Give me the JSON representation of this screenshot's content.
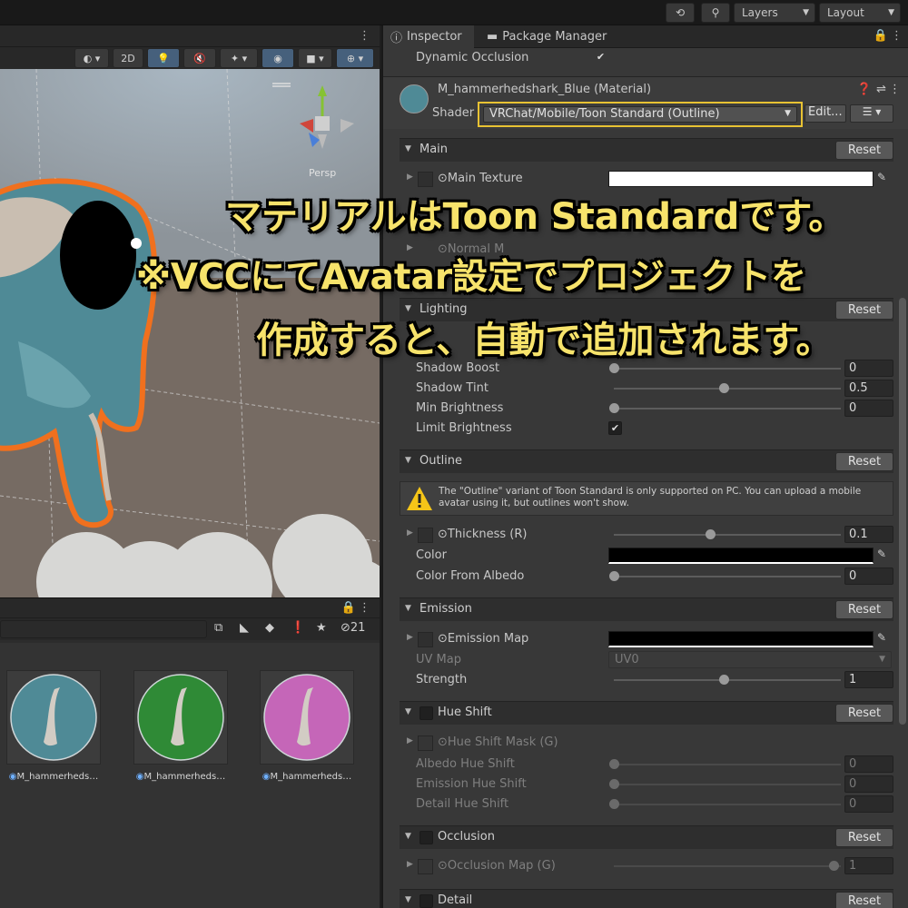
{
  "topbar": {
    "layers_label": "Layers",
    "layout_label": "Layout",
    "history_icon": "history-icon",
    "search_icon": "search-icon"
  },
  "scene": {
    "mode_2d": "2D",
    "persp_label": "Persp"
  },
  "project": {
    "hidden_count": "21",
    "assets": [
      {
        "name": "M_hammerheds…",
        "color": "#4f8a96"
      },
      {
        "name": "M_hammerheds…",
        "color": "#2f8a36"
      },
      {
        "name": "M_hammerheds…",
        "color": "#c566b8"
      }
    ]
  },
  "inspector": {
    "tabs": [
      "Inspector",
      "Package Manager"
    ],
    "dynamic_occlusion_label": "Dynamic Occlusion",
    "material_name": "M_hammerhedshark_Blue (Material)",
    "shader_label": "Shader",
    "shader_value": "VRChat/Mobile/Toon Standard (Outline)",
    "edit_label": "Edit...",
    "reset_label": "Reset",
    "main": {
      "title": "Main",
      "main_texture": "Main Texture",
      "normal_map": "Normal M"
    },
    "lighting": {
      "title": "Lighting",
      "shadow_boost": {
        "label": "Shadow Boost",
        "value": "0"
      },
      "shadow_tint": {
        "label": "Shadow Tint",
        "value": "0.5"
      },
      "min_brightness": {
        "label": "Min Brightness",
        "value": "0"
      },
      "limit_brightness": {
        "label": "Limit Brightness",
        "checked": true
      }
    },
    "outline": {
      "title": "Outline",
      "warning": "The \"Outline\" variant of Toon Standard is only supported on PC. You can upload a mobile avatar using it, but outlines won't show.",
      "thickness": {
        "label": "Thickness (R)",
        "value": "0.1"
      },
      "color_label": "Color",
      "color_from_albedo": {
        "label": "Color From Albedo",
        "value": "0"
      }
    },
    "emission": {
      "title": "Emission",
      "emission_map": "Emission Map",
      "uv_map_label": "UV Map",
      "uv_map_value": "UV0",
      "strength": {
        "label": "Strength",
        "value": "1"
      }
    },
    "hue_shift": {
      "title": "Hue Shift",
      "mask": "Hue Shift Mask (G)",
      "albedo": {
        "label": "Albedo Hue Shift",
        "value": "0"
      },
      "emission": {
        "label": "Emission Hue Shift",
        "value": "0"
      },
      "detail": {
        "label": "Detail Hue Shift",
        "value": "0"
      }
    },
    "occlusion": {
      "title": "Occlusion",
      "map": {
        "label": "Occlusion Map (G)",
        "value": "1"
      }
    },
    "detail": {
      "title": "Detail"
    }
  },
  "caption": {
    "line1": "マテリアルはToon Standardです。",
    "line2": "※VCCにてAvatar設定でプロジェクトを",
    "line3": "作成すると、自動で追加されます。"
  },
  "colors": {
    "accent_yellow": "#f7e36b",
    "highlight_box": "#e8c233",
    "outline_orange": "#f0701e",
    "shark_blue": "#4f8a96"
  }
}
